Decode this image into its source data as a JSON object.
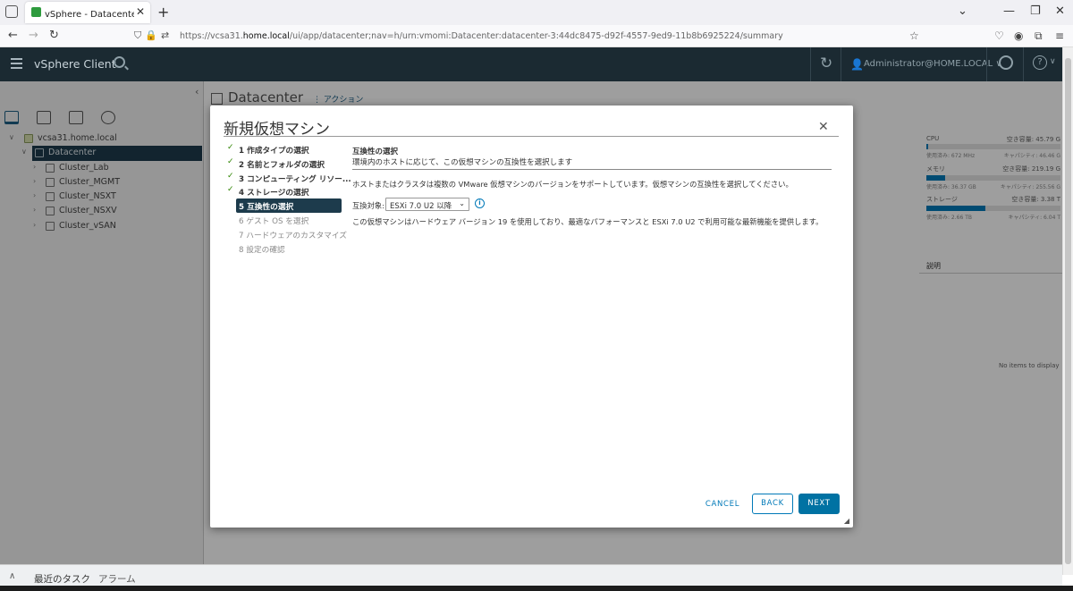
{
  "browser": {
    "tab_title": "vSphere - Datacenter - サマリ",
    "url_prefix": "https://vcsa31.",
    "url_domain": "home.local",
    "url_path": "/ui/app/datacenter;nav=h/urn:vmomi:Datacenter:datacenter-3:44dc8475-d92f-4557-9ed9-11b8b6925224/summary"
  },
  "vsphere": {
    "app_title": "vSphere Client",
    "user": "Administrator@HOME.LOCAL ∨"
  },
  "tree": {
    "vcenter": "vcsa31.home.local",
    "datacenter": "Datacenter",
    "clusters": [
      "Cluster_Lab",
      "Cluster_MGMT",
      "Cluster_NSXT",
      "Cluster_NSXV",
      "Cluster_vSAN"
    ]
  },
  "background": {
    "title": "Datacenter",
    "actions": "アクション",
    "resources": [
      {
        "name": "CPU",
        "free": "空き容量: 45.79 G",
        "used": "使用済み: 672 MHz",
        "cap": "キャパシティ: 46.46 G",
        "fill": 0.015
      },
      {
        "name": "メモリ",
        "free": "空き容量: 219.19 G",
        "used": "使用済み: 36.37 GB",
        "cap": "キャパシティ: 255.56 G",
        "fill": 0.14
      },
      {
        "name": "ストレージ",
        "free": "空き容量: 3.38 T",
        "used": "使用済み: 2.66 TB",
        "cap": "キャパシティ: 6.04 T",
        "fill": 0.44
      }
    ],
    "table_header": "説明",
    "no_items": "No items to display"
  },
  "bottom": {
    "recent_tasks": "最近のタスク",
    "alarms": "アラーム"
  },
  "modal": {
    "title": "新規仮想マシン",
    "steps": [
      {
        "label": "1 作成タイプの選択",
        "state": "done"
      },
      {
        "label": "2 名前とフォルダの選択",
        "state": "done"
      },
      {
        "label": "3 コンピューティング リソー...",
        "state": "done"
      },
      {
        "label": "4 ストレージの選択",
        "state": "done"
      },
      {
        "label": "5 互換性の選択",
        "state": "current"
      },
      {
        "label": "6 ゲスト OS を選択",
        "state": "future"
      },
      {
        "label": "7 ハードウェアのカスタマイズ",
        "state": "future"
      },
      {
        "label": "8 設定の確認",
        "state": "future"
      }
    ],
    "heading": "互換性の選択",
    "subheading": "環境内のホストに応じて、この仮想マシンの互換性を選択します",
    "description": "ホストまたはクラスタは複数の VMware 仮想マシンのバージョンをサポートしています。仮想マシンの互換性を選択してください。",
    "compat_label": "互換対象:",
    "compat_value": "ESXi 7.0 U2 以降",
    "note": "この仮想マシンはハードウェア バージョン 19 を使用しており、最適なパフォーマンスと ESXi 7.0 U2 で利用可能な最新機能を提供します。",
    "buttons": {
      "cancel": "CANCEL",
      "back": "BACK",
      "next": "NEXT"
    }
  }
}
